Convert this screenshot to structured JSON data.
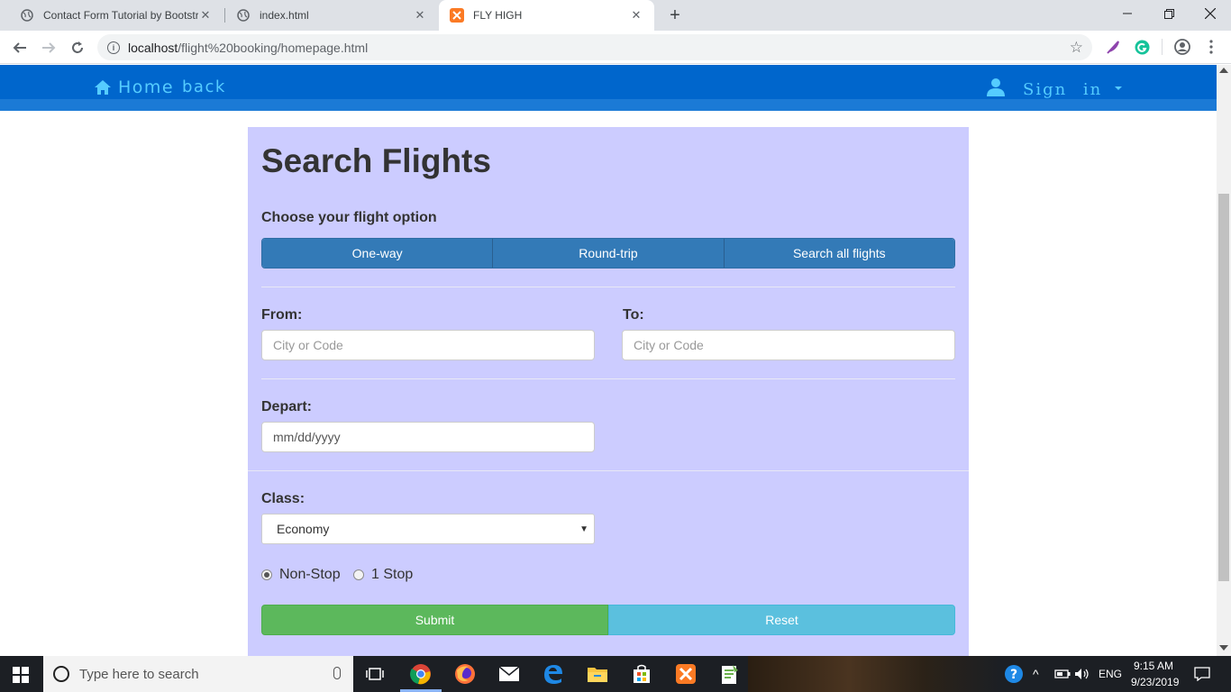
{
  "browser": {
    "tabs": [
      {
        "title": "Contact Form Tutorial by Bootstr",
        "active": false
      },
      {
        "title": "index.html",
        "active": false
      },
      {
        "title": "FLY HIGH",
        "active": true
      }
    ],
    "url_host": "localhost",
    "url_path": "/flight%20booking/homepage.html"
  },
  "navbar": {
    "home_label": "Home",
    "back_label": "back",
    "signin_label": "Sign in",
    "bg_color": "#0066cc",
    "link_color": "#55ccff"
  },
  "form": {
    "title": "Search Flights",
    "option_heading": "Choose your flight option",
    "options": [
      "One-way",
      "Round-trip",
      "Search all flights"
    ],
    "from_label": "From:",
    "from_placeholder": "City or Code",
    "to_label": "To:",
    "to_placeholder": "City or Code",
    "depart_label": "Depart:",
    "depart_value": "mm/dd/yyyy",
    "class_label": "Class:",
    "class_selected": "Economy",
    "stops": [
      {
        "label": "Non-Stop",
        "checked": true
      },
      {
        "label": "1 Stop",
        "checked": false
      }
    ],
    "submit_label": "Submit",
    "reset_label": "Reset",
    "panel_color": "#ccccff"
  },
  "taskbar": {
    "search_placeholder": "Type here to search",
    "language": "ENG",
    "time": "9:15 AM",
    "date": "9/23/2019"
  }
}
